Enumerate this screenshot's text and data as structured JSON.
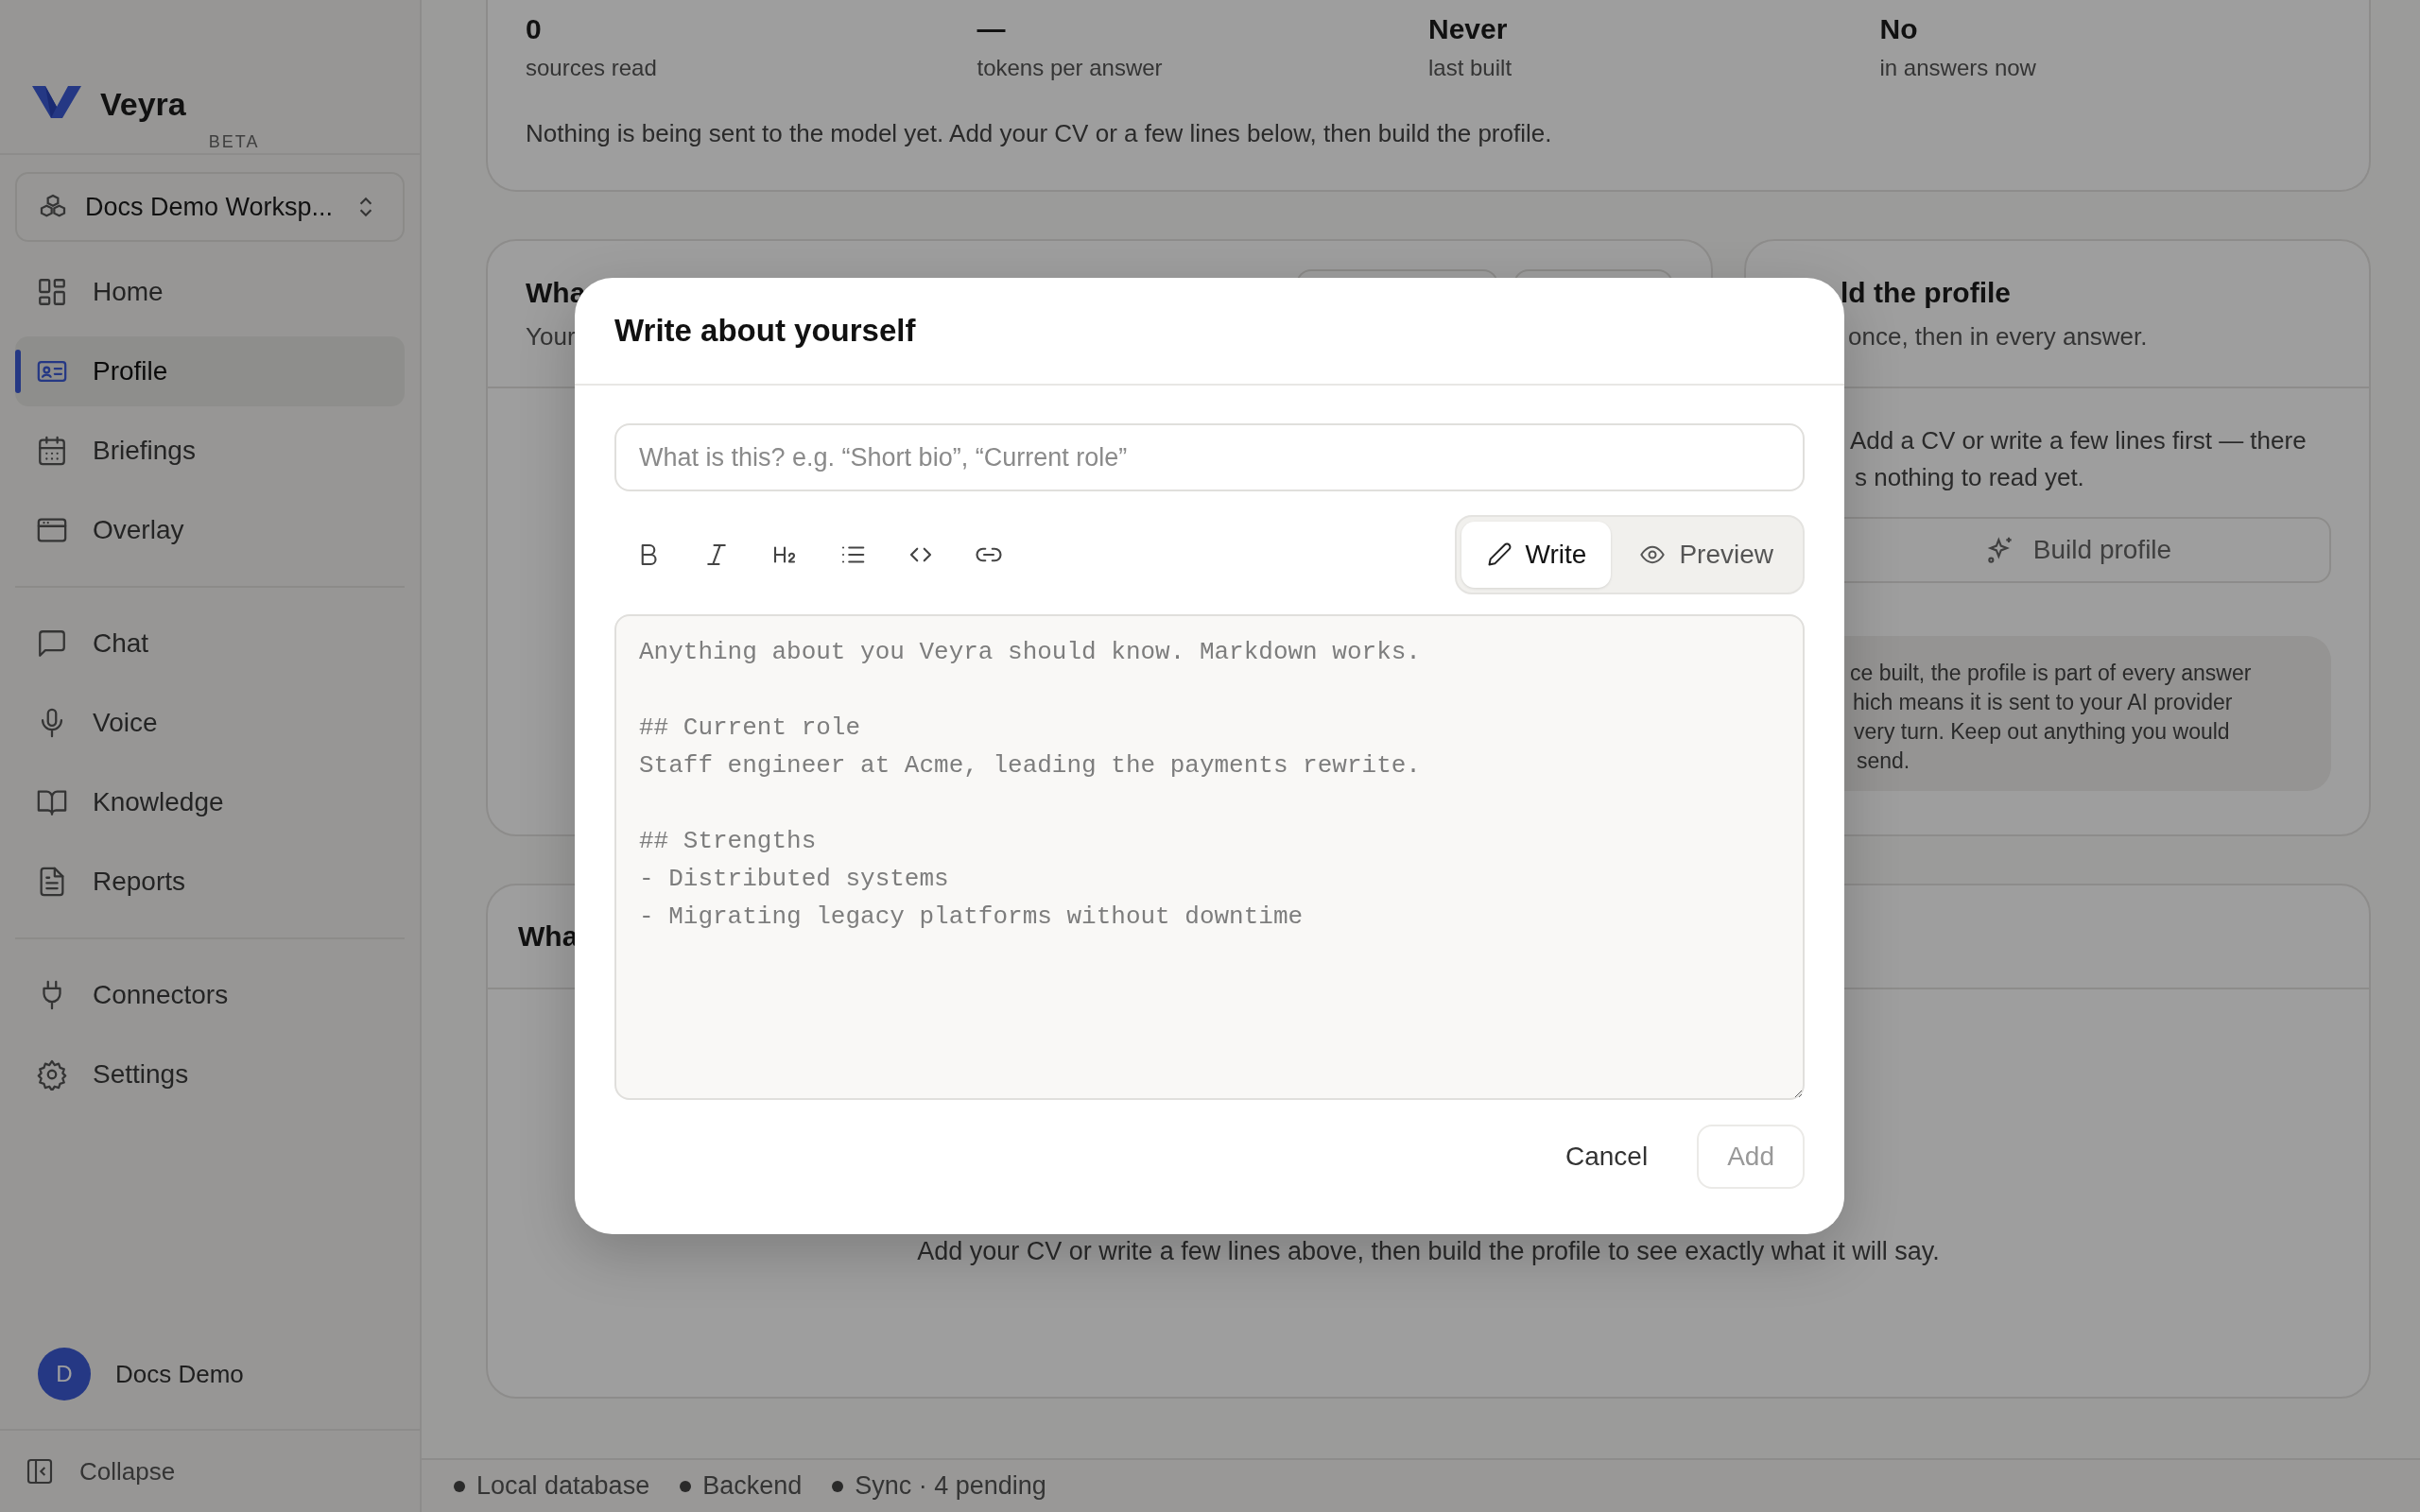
{
  "sidebar": {
    "brand": "Veyra",
    "badge": "BETA",
    "workspace": "Docs Demo Worksp...",
    "sections": [
      [
        {
          "label": "Home",
          "selected": false
        },
        {
          "label": "Profile",
          "selected": true
        },
        {
          "label": "Briefings",
          "selected": false
        },
        {
          "label": "Overlay",
          "selected": false
        }
      ],
      [
        {
          "label": "Chat",
          "selected": false
        },
        {
          "label": "Voice",
          "selected": false
        },
        {
          "label": "Knowledge",
          "selected": false
        },
        {
          "label": "Reports",
          "selected": false
        }
      ],
      [
        {
          "label": "Connectors",
          "selected": false
        },
        {
          "label": "Settings",
          "selected": false
        }
      ]
    ],
    "user": {
      "initial": "D",
      "name": "Docs Demo"
    },
    "collapse": "Collapse"
  },
  "stats": {
    "items": [
      {
        "value": "0",
        "label": "sources read"
      },
      {
        "value": "—",
        "label": "tokens per answer"
      },
      {
        "value": "Never",
        "label": "last built"
      },
      {
        "value": "No",
        "label": "in answers now"
      }
    ],
    "note": "Nothing is being sent to the model yet. Add your CV or a few lines below, then build the profile."
  },
  "left_card": {
    "title": "Wha",
    "subtitle": "Your"
  },
  "right_card": {
    "title": "ld the profile",
    "subtitle": "once, then in every answer.",
    "hint_lines": [
      "Add a CV or write a few lines first — there",
      "s nothing to read yet."
    ],
    "button": "Build profile",
    "notice_lines": [
      "ce built, the profile is part of every answer",
      "hich means it is sent to your AI provider",
      "very turn. Keep out anything you would",
      "send."
    ]
  },
  "bottom_card": {
    "title": "Wha",
    "empty_text": "Add your CV or write a few lines above, then build the profile to see exactly what it will say."
  },
  "status_bar": [
    "Local database",
    "Backend",
    "Sync · 4 pending"
  ],
  "dialog": {
    "title": "Write about yourself",
    "name_placeholder": "What is this? e.g. “Short bio”, “Current role”",
    "modes": [
      {
        "label": "Write",
        "selected": true
      },
      {
        "label": "Preview",
        "selected": false
      }
    ],
    "body_placeholder": "Anything about you Veyra should know. Markdown works.\n\n## Current role\nStaff engineer at Acme, leading the payments rewrite.\n\n## Strengths\n- Distributed systems\n- Migrating legacy platforms without downtime",
    "cancel": "Cancel",
    "add": "Add",
    "add_disabled": true
  }
}
